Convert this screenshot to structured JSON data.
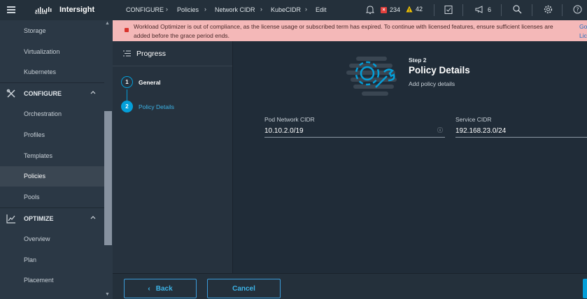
{
  "app": {
    "brand": "Intersight",
    "logo_text": "cisco"
  },
  "sidebar": {
    "items": [
      {
        "label": "Storage",
        "type": "item"
      },
      {
        "label": "Virtualization",
        "type": "item"
      },
      {
        "label": "Kubernetes",
        "type": "item"
      },
      {
        "label": "CONFIGURE",
        "type": "section",
        "icon": "wrench-screwdriver-icon",
        "expanded": true
      },
      {
        "label": "Orchestration",
        "type": "item"
      },
      {
        "label": "Profiles",
        "type": "item"
      },
      {
        "label": "Templates",
        "type": "item"
      },
      {
        "label": "Policies",
        "type": "item",
        "active": true
      },
      {
        "label": "Pools",
        "type": "item"
      },
      {
        "label": "OPTIMIZE",
        "type": "section",
        "icon": "chart-line-icon",
        "expanded": true
      },
      {
        "label": "Overview",
        "type": "item"
      },
      {
        "label": "Plan",
        "type": "item"
      },
      {
        "label": "Placement",
        "type": "item"
      }
    ]
  },
  "breadcrumb": [
    "CONFIGURE",
    "Policies",
    "Network CIDR",
    "KubeCIDR",
    "Edit"
  ],
  "topbar": {
    "critical_count": "234",
    "warning_count": "42",
    "announcement_count": "6"
  },
  "alert": {
    "line1": "Workload Optimizer is out of compliance, as the license usage or subscribed term has expired. To continue with licensed features, ensure sufficient licenses are",
    "line2": "added before the grace period ends.",
    "link1": "Go",
    "link2": "Lic"
  },
  "progress": {
    "title": "Progress",
    "steps": [
      {
        "num": "1",
        "label": "General"
      },
      {
        "num": "2",
        "label": "Policy Details"
      }
    ]
  },
  "main": {
    "step_num": "Step 2",
    "step_title": "Policy Details",
    "step_desc": "Add policy details",
    "pod_cidr": {
      "label": "Pod Network CIDR",
      "value": "10.10.2.0/19"
    },
    "service_cidr": {
      "label": "Service CIDR",
      "value": "192.168.23.0/24"
    }
  },
  "footer": {
    "back_label": "Back",
    "cancel_label": "Cancel"
  },
  "colors": {
    "accent": "#049fd9",
    "alert_bg": "#f4b8b8",
    "critical": "#e2413d",
    "warning": "#f5c400"
  }
}
